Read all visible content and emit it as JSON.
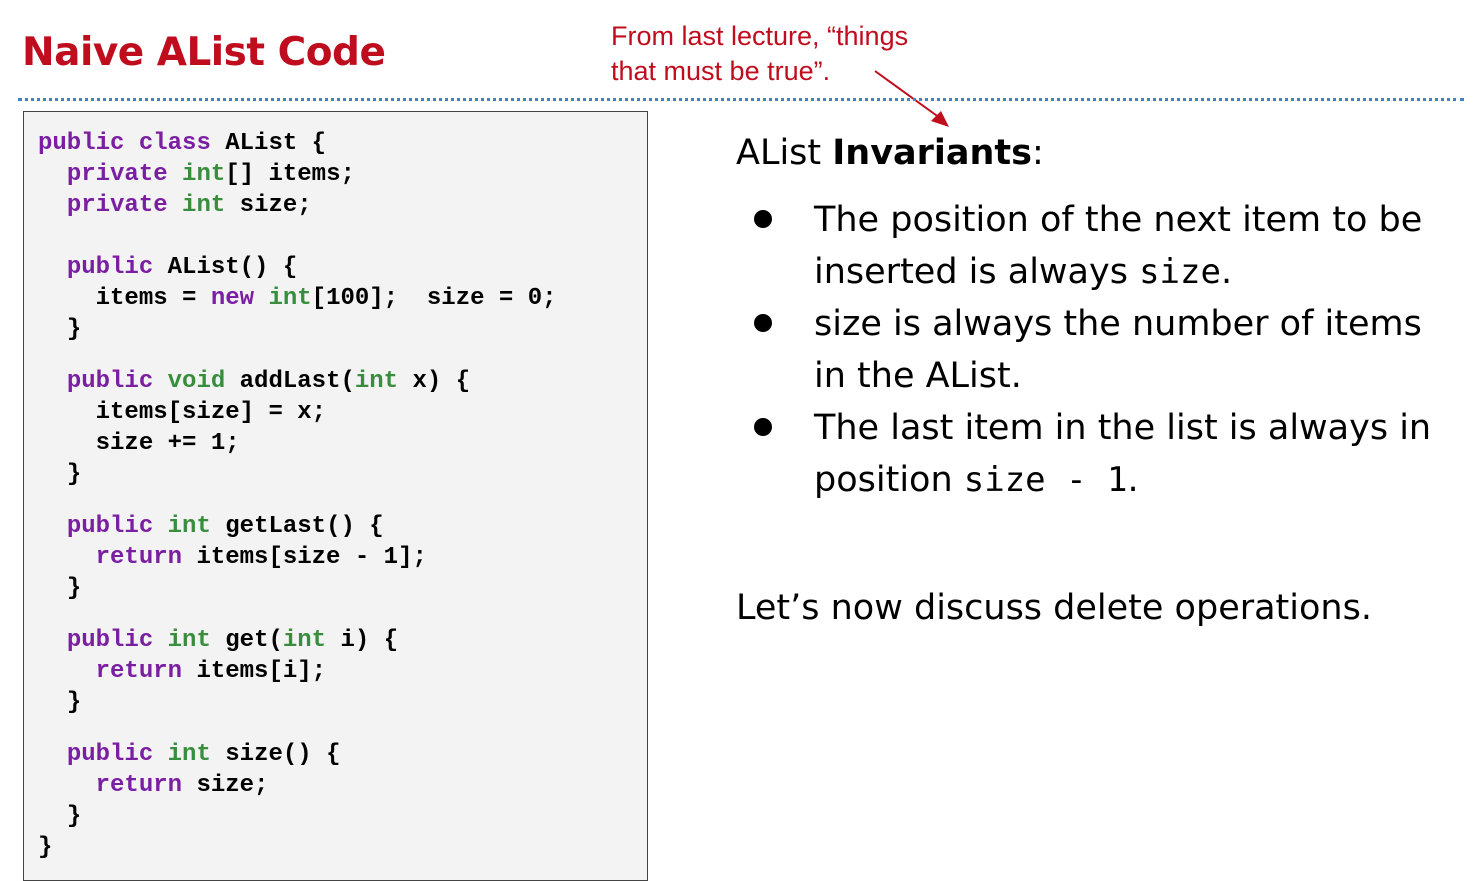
{
  "title": "Naive AList Code",
  "annotation": {
    "line1": "From last lecture, “things",
    "line2": "that must be true”."
  },
  "colors": {
    "title": "#c00d1e",
    "annotation": "#c00d1e",
    "keyword": "#7b1fa2",
    "type": "#388e3c",
    "divider": "#3d85c6",
    "code_background": "#f3f3f3"
  },
  "code": {
    "class_decl": {
      "kw1": "public",
      "kw2": "class",
      "name": "AList {"
    },
    "field_items": {
      "kw": "private",
      "type": "int",
      "rest": "[] items;"
    },
    "field_size": {
      "kw": "private",
      "type": "int",
      "rest": "size;"
    },
    "ctor": {
      "kw": "public",
      "sig": "AList() {",
      "body_a": "items = ",
      "new_kw": "new",
      "type": "int",
      "body_b": "[100];  size = 0;",
      "close": "}"
    },
    "add_last": {
      "kw": "public",
      "ret": "void",
      "name": "addLast(",
      "param_type": "int",
      "param": "x) {",
      "body1": "items[size] = x;",
      "body2": "size += 1;",
      "close": "}"
    },
    "get_last": {
      "kw": "public",
      "ret": "int",
      "name": "getLast() {",
      "ret_kw": "return",
      "ret_expr": "items[size - 1];",
      "close": "}"
    },
    "get": {
      "kw": "public",
      "ret": "int",
      "name": "get(",
      "param_type": "int",
      "param": "i) {",
      "ret_kw": "return",
      "ret_expr": "items[i];",
      "close": "}"
    },
    "size_method": {
      "kw": "public",
      "ret": "int",
      "name": "size() {",
      "ret_kw": "return",
      "ret_expr": "size;",
      "close": "}"
    },
    "class_close": "}"
  },
  "invariants": {
    "heading_pre": "AList ",
    "heading_bold": "Invariants",
    "heading_post": ":",
    "items": [
      {
        "text": "The position of the next item to be inserted is always ",
        "code": "size",
        "suffix": "."
      },
      {
        "text": "size is always the number of items in the AList.",
        "code": "",
        "suffix": ""
      },
      {
        "text": "The last item in the list is always in position ",
        "code": "size - 1",
        "suffix": "."
      }
    ]
  },
  "closing": "Let’s now discuss delete operations."
}
